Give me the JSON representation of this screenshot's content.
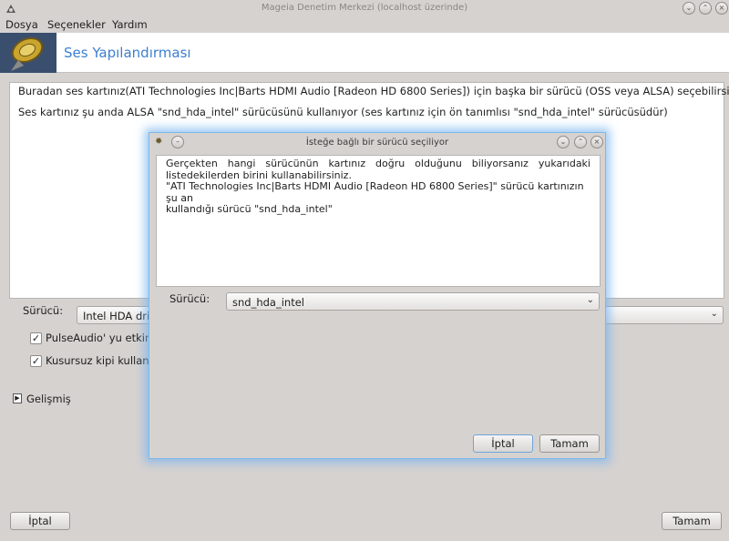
{
  "window": {
    "title": "Mageia Denetim Merkezi  (localhost üzerinde)",
    "controls": [
      "chevron-down",
      "chevron-up",
      "close"
    ]
  },
  "menu": {
    "items": [
      "Dosya",
      "Seçenekler",
      "Yardım"
    ]
  },
  "header": {
    "title": "Ses Yapılandırması"
  },
  "main": {
    "info_line1": "Buradan ses kartınız(ATI Technologies Inc|Barts HDMI Audio [Radeon HD 6800 Series]) için başka bir sürücü (OSS veya ALSA) seçebilirsiniz",
    "info_line2": "Ses kartınız şu anda ALSA \"snd_hda_intel\" sürücüsünü kullanıyor (ses kartınız için ön tanımlısı \"snd_hda_intel\" sürücüsüdür)",
    "driver_label": "Sürücü:",
    "driver_value": "Intel HDA driver",
    "checkbox_pulseaudio": "PulseAudio' yu etkinleştir",
    "checkbox_glitchfree": "Kusursuz kipi kullan",
    "advanced_label": "Gelişmiş",
    "cancel_label": "İptal",
    "ok_label": "Tamam"
  },
  "dialog": {
    "title": "İsteğe bağlı bir sürücü seçiliyor",
    "line1": "Gerçekten hangi sürücünün kartınız doğru olduğunu biliyorsanız yukarıdaki",
    "line2": "listedekilerden birini kullanabilirsiniz.",
    "line3": "\"ATI Technologies Inc|Barts HDMI Audio [Radeon HD 6800 Series]\" sürücü kartınızın şu an",
    "line4": "kullandığı sürücü \"snd_hda_intel\"",
    "driver_label": "Sürücü:",
    "driver_value": "snd_hda_intel",
    "cancel_label": "İptal",
    "ok_label": "Tamam"
  },
  "colors": {
    "accent": "#3c7fd1",
    "dialog_glow": "#7fb7e8",
    "window_bg": "#d6d2d0"
  }
}
